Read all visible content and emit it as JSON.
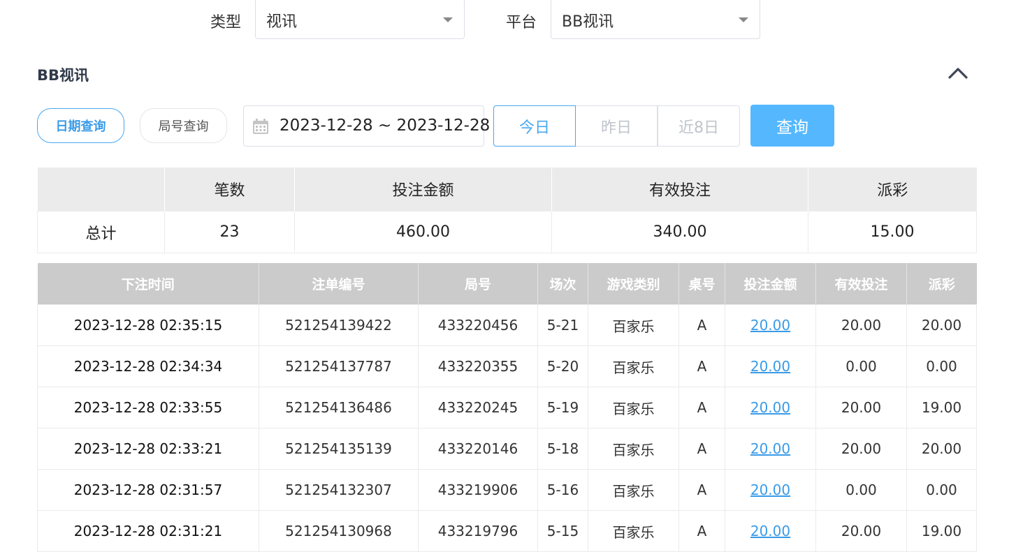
{
  "filters": {
    "type_label": "类型",
    "type_value": "视讯",
    "platform_label": "平台",
    "platform_value": "BB视讯"
  },
  "section": {
    "title": "BB视讯"
  },
  "query_tabs": {
    "date_query": "日期查询",
    "round_query": "局号查询"
  },
  "date_range": {
    "value": "2023-12-28 ~ 2023-12-28"
  },
  "quick_dates": {
    "today": "今日",
    "yesterday": "昨日",
    "last8": "近8日"
  },
  "query_button": "查询",
  "summary": {
    "headers": [
      "",
      "笔数",
      "投注金额",
      "有效投注",
      "派彩"
    ],
    "row": [
      "总计",
      "23",
      "460.00",
      "340.00",
      "15.00"
    ]
  },
  "detail": {
    "headers": [
      "下注时间",
      "注单编号",
      "局号",
      "场次",
      "游戏类别",
      "桌号",
      "投注金额",
      "有效投注",
      "派彩"
    ],
    "rows": [
      [
        "2023-12-28 02:35:15",
        "521254139422",
        "433220456",
        "5-21",
        "百家乐",
        "A",
        "20.00",
        "20.00",
        "20.00"
      ],
      [
        "2023-12-28 02:34:34",
        "521254137787",
        "433220355",
        "5-20",
        "百家乐",
        "A",
        "20.00",
        "0.00",
        "0.00"
      ],
      [
        "2023-12-28 02:33:55",
        "521254136486",
        "433220245",
        "5-19",
        "百家乐",
        "A",
        "20.00",
        "20.00",
        "19.00"
      ],
      [
        "2023-12-28 02:33:21",
        "521254135139",
        "433220146",
        "5-18",
        "百家乐",
        "A",
        "20.00",
        "20.00",
        "20.00"
      ],
      [
        "2023-12-28 02:31:57",
        "521254132307",
        "433219906",
        "5-16",
        "百家乐",
        "A",
        "20.00",
        "0.00",
        "0.00"
      ],
      [
        "2023-12-28 02:31:21",
        "521254130968",
        "433219796",
        "5-15",
        "百家乐",
        "A",
        "20.00",
        "20.00",
        "19.00"
      ]
    ]
  },
  "colors": {
    "accent": "#47a8f0",
    "query_button": "#55b8ff",
    "summary_header": "#ebebeb",
    "detail_header": "#cbcbcb"
  },
  "icons": {
    "calendar": "calendar-icon",
    "collapse": "chevron-up-icon",
    "dropdown": "caret-down-icon"
  }
}
